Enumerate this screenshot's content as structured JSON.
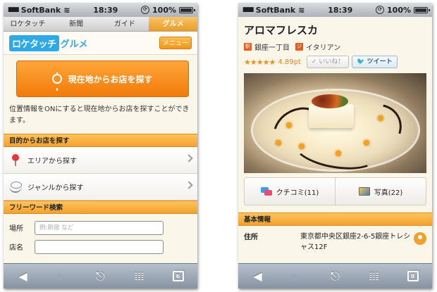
{
  "left": {
    "status": {
      "carrier": "SoftBank",
      "time": "18:39",
      "battery": "100%"
    },
    "nav_tabs": [
      "ロケタッチ",
      "新聞",
      "ガイド",
      "グルメ"
    ],
    "brand": {
      "logo": "ロケタッチ",
      "logo_sub": "グルメ",
      "menu_label": "メニュー"
    },
    "locate_button": "現在地からお店を探す",
    "description": "位置情報をONにすると現在地からお店を探すことができます。",
    "purpose_section": "目的からお店を探す",
    "area_item": "エリアから探す",
    "genre_item": "ジャンルから探す",
    "freeword_section": "フリーワード検索",
    "place_label": "場所",
    "place_placeholder": "例:新宿 など",
    "shop_label": "店名",
    "tab_count": "6"
  },
  "right": {
    "status": {
      "carrier": "SoftBank",
      "time": "18:39",
      "battery": "100%"
    },
    "restaurant_name": "アロマフレスカ",
    "area": "銀座一丁目",
    "genre": "イタリアン",
    "rating_stars": "★★★★★",
    "rating_points": "4.89pt",
    "like_label": "いいね！",
    "tweet_label": "ツイート",
    "reviews_label": "クチコミ(11)",
    "photos_label": "写真(22)",
    "info_section": "基本情報",
    "address_label": "住所",
    "address_value": "東京都中央区銀座2-6-5銀座トレシャス12F",
    "tab_count": "8"
  },
  "colors": {
    "accent": "#f39418",
    "logo": "#2fa8e6",
    "toolbar": "#8793a2"
  },
  "icons": [
    "wifi-icon",
    "lock-icon",
    "battery-icon",
    "target-icon",
    "pin-icon",
    "dish-icon",
    "chevron-right-icon",
    "back-icon",
    "forward-icon",
    "share-icon",
    "bookmarks-icon",
    "tabs-icon",
    "star-icon",
    "comment-icon",
    "photo-icon",
    "map-pin-icon"
  ]
}
